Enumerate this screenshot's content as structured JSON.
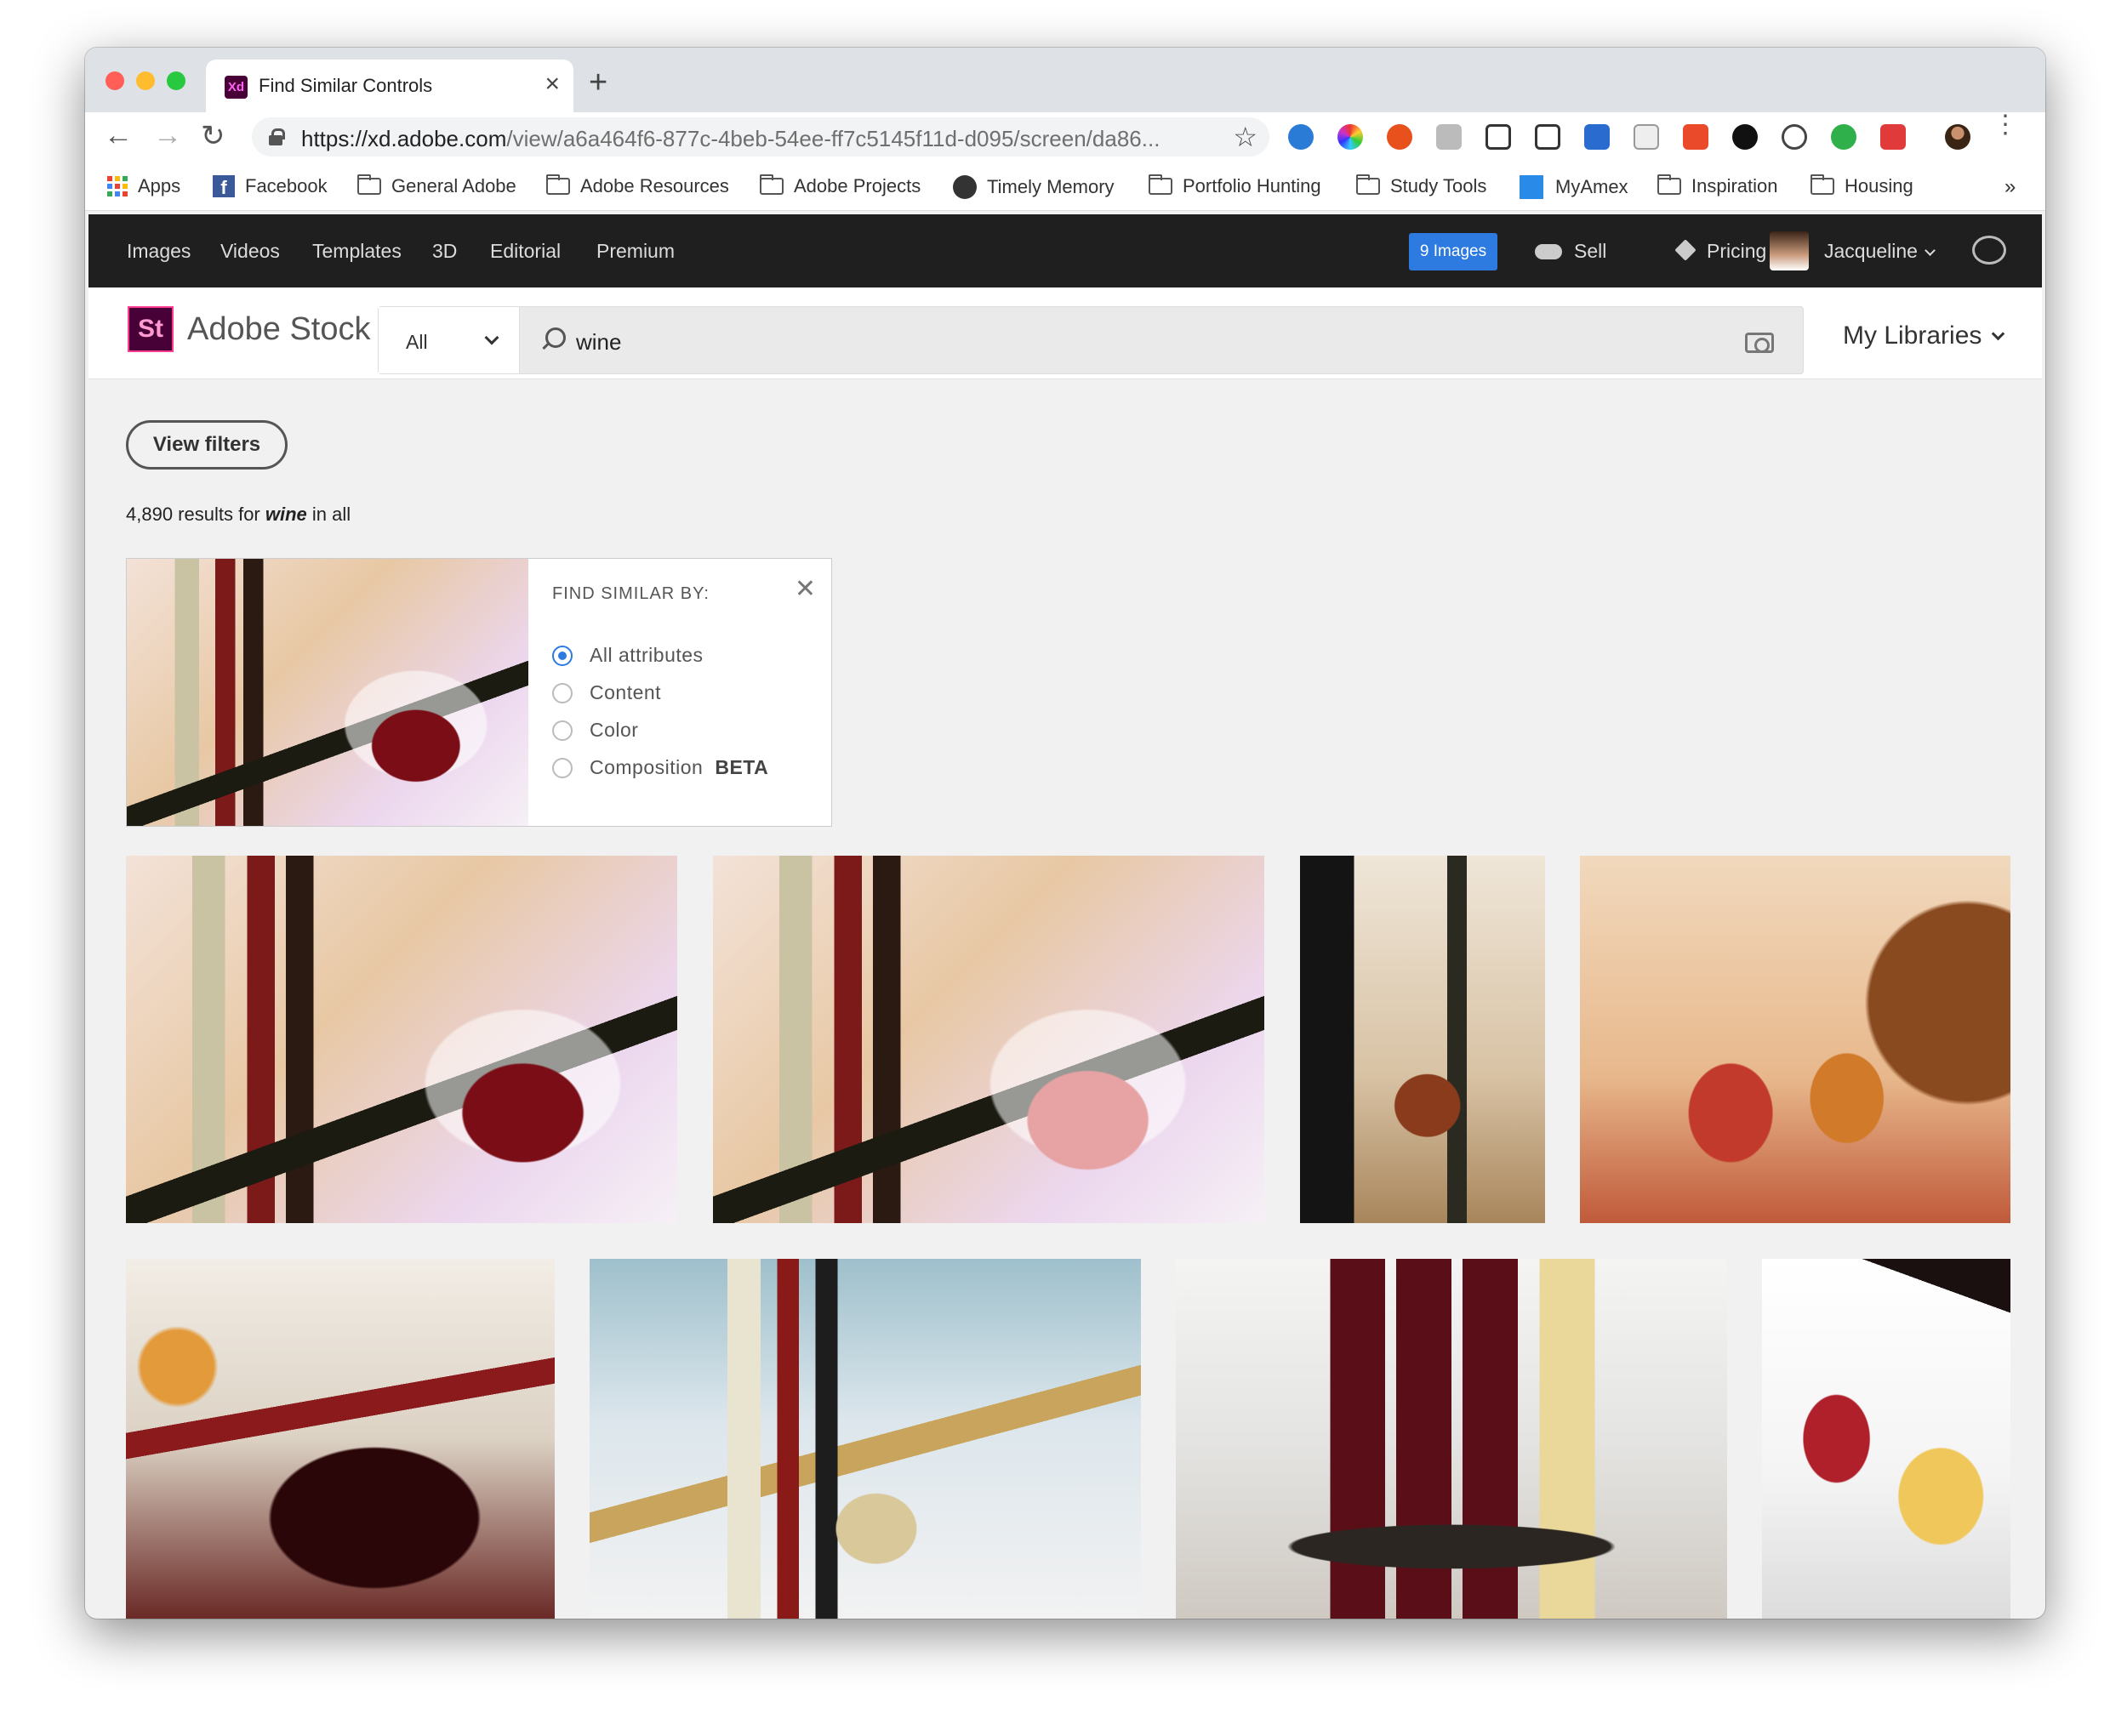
{
  "browser": {
    "tab_title": "Find Similar Controls",
    "tab_favicon_text": "Xd",
    "url_host": "https://xd.adobe.com",
    "url_path": "/view/a6a464f6-877c-4beb-54ee-ff7c5145f11d-d095/screen/da86...",
    "bookmarks": [
      "Apps",
      "Facebook",
      "General Adobe",
      "Adobe Resources",
      "Adobe Projects",
      "Timely Memory",
      "Portfolio Hunting",
      "Study Tools",
      "MyAmex",
      "Inspiration",
      "Housing"
    ],
    "overflow": "»"
  },
  "topnav": {
    "items": [
      "Images",
      "Videos",
      "Templates",
      "3D",
      "Editorial",
      "Premium"
    ],
    "images_button": "9 Images",
    "sell": "Sell",
    "pricing": "Pricing",
    "user": "Jacqueline"
  },
  "search": {
    "logo_text": "St",
    "brand": "Adobe Stock",
    "category": "All",
    "query": "wine",
    "my_libraries": "My Libraries"
  },
  "content": {
    "view_filters": "View filters",
    "results_count": "4,890",
    "results_for": " results for ",
    "results_query": "wine",
    "results_suffix": " in all"
  },
  "find_similar": {
    "header": "FIND SIMILAR BY:",
    "options": [
      {
        "label": "All attributes",
        "selected": true
      },
      {
        "label": "Content",
        "selected": false
      },
      {
        "label": "Color",
        "selected": false
      },
      {
        "label": "Composition",
        "selected": false,
        "badge": "BETA"
      }
    ]
  },
  "colors": {
    "accent_blue": "#2d7be0",
    "nav_bg": "#1f1f1f",
    "stock_logo_bg": "#470137"
  }
}
